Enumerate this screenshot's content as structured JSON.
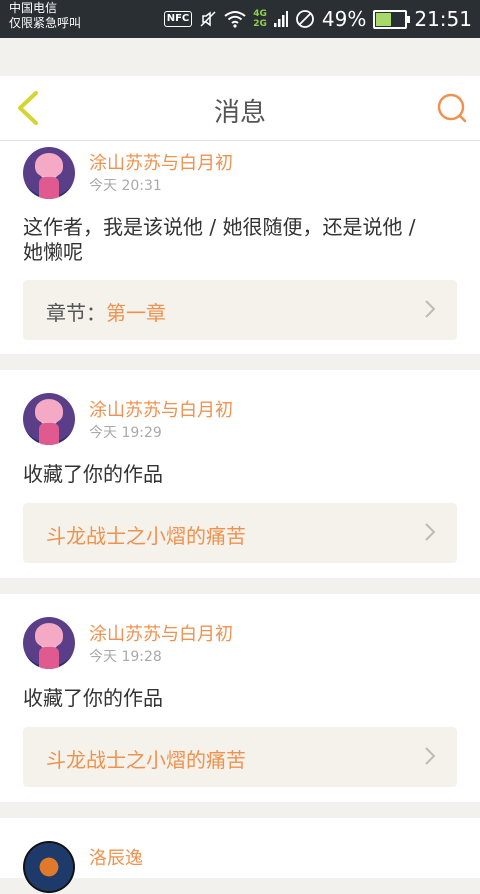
{
  "status_bar": {
    "carrier_line1": "中国电信",
    "carrier_line2": "仅限紧急呼叫",
    "nfc_label": "NFC",
    "net_4g": "4G",
    "net_2g": "2G",
    "battery_percent": "49%",
    "battery_level": 0.49,
    "time": "21:51"
  },
  "header": {
    "title": "消息",
    "back_icon": "chevron-left-icon",
    "search_icon": "search-icon"
  },
  "colors": {
    "accent": "#f0924f",
    "back_icon": "#d4d432",
    "target_box_bg": "#f4f2ea"
  },
  "messages": [
    {
      "username": "涂山苏苏与白月初",
      "time": "今天 20:31",
      "text": "这作者，我是该说他 / 她很随便，还是说他 / 她懒呢",
      "target_prefix": "章节：",
      "target_value": "第一章"
    },
    {
      "username": "涂山苏苏与白月初",
      "time": "今天 19:29",
      "text": "收藏了你的作品",
      "target_prefix": "",
      "target_value": "斗龙战士之小熠的痛苦"
    },
    {
      "username": "涂山苏苏与白月初",
      "time": "今天 19:28",
      "text": "收藏了你的作品",
      "target_prefix": "",
      "target_value": "斗龙战士之小熠的痛苦"
    },
    {
      "username": "洛辰逸"
    }
  ]
}
